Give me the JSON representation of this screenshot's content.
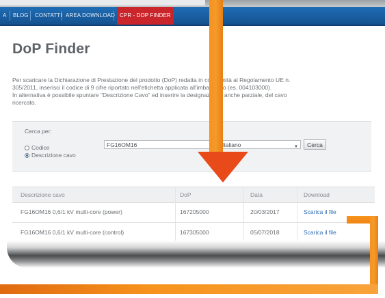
{
  "nav": {
    "items": [
      "A",
      "BLOG",
      "CONTATTI",
      "AREA DOWNLOAD",
      "CPR - DOP FINDER"
    ],
    "active_index": 4,
    "active_color": "#c9252b",
    "bar_color": "#1f6db6"
  },
  "page": {
    "title": "DoP Finder",
    "intro_line1": "Per scaricare la Dichiarazione di Prestazione del prodotto (DoP) redatta in conformità al Regolamento UE n.",
    "intro_line2": "305/2011, inserisci il codice di 9 cifre riportato nell'etichetta applicata all'imballaggio (es. 004103000).",
    "intro_line3": "In alternativa è possibile spuntare \"Descrizione Cavo\" ed inserire la designazione, anche parziale, del cavo",
    "intro_line4": "ricercato."
  },
  "search": {
    "label": "Cerca per:",
    "option_code": "Codice",
    "option_description": "Descrizione cavo",
    "selected_option": "Descrizione cavo",
    "input_value": "FG16OM16",
    "language_value": "Italiano",
    "button_label": "Cerca"
  },
  "table": {
    "headers": [
      "Descrizione cavo",
      "DoP",
      "Data",
      "Download"
    ],
    "rows": [
      [
        "FG16OM16 0,6/1 kV multi-core (power)",
        "167205000",
        "20/03/2017",
        "Scarica il file"
      ],
      [
        "FG16OM16 0,6/1 kV multi-core (control)",
        "167305000",
        "05/07/2018",
        "Scarica il file"
      ]
    ]
  },
  "colors": {
    "accent_orange": "#f7931d",
    "arrow_red": "#e84a1a",
    "link_blue": "#2e6bb5"
  },
  "icons": [
    "radio-button-icon",
    "dropdown-arrow-icon",
    "down-arrow-pointer-icon"
  ]
}
